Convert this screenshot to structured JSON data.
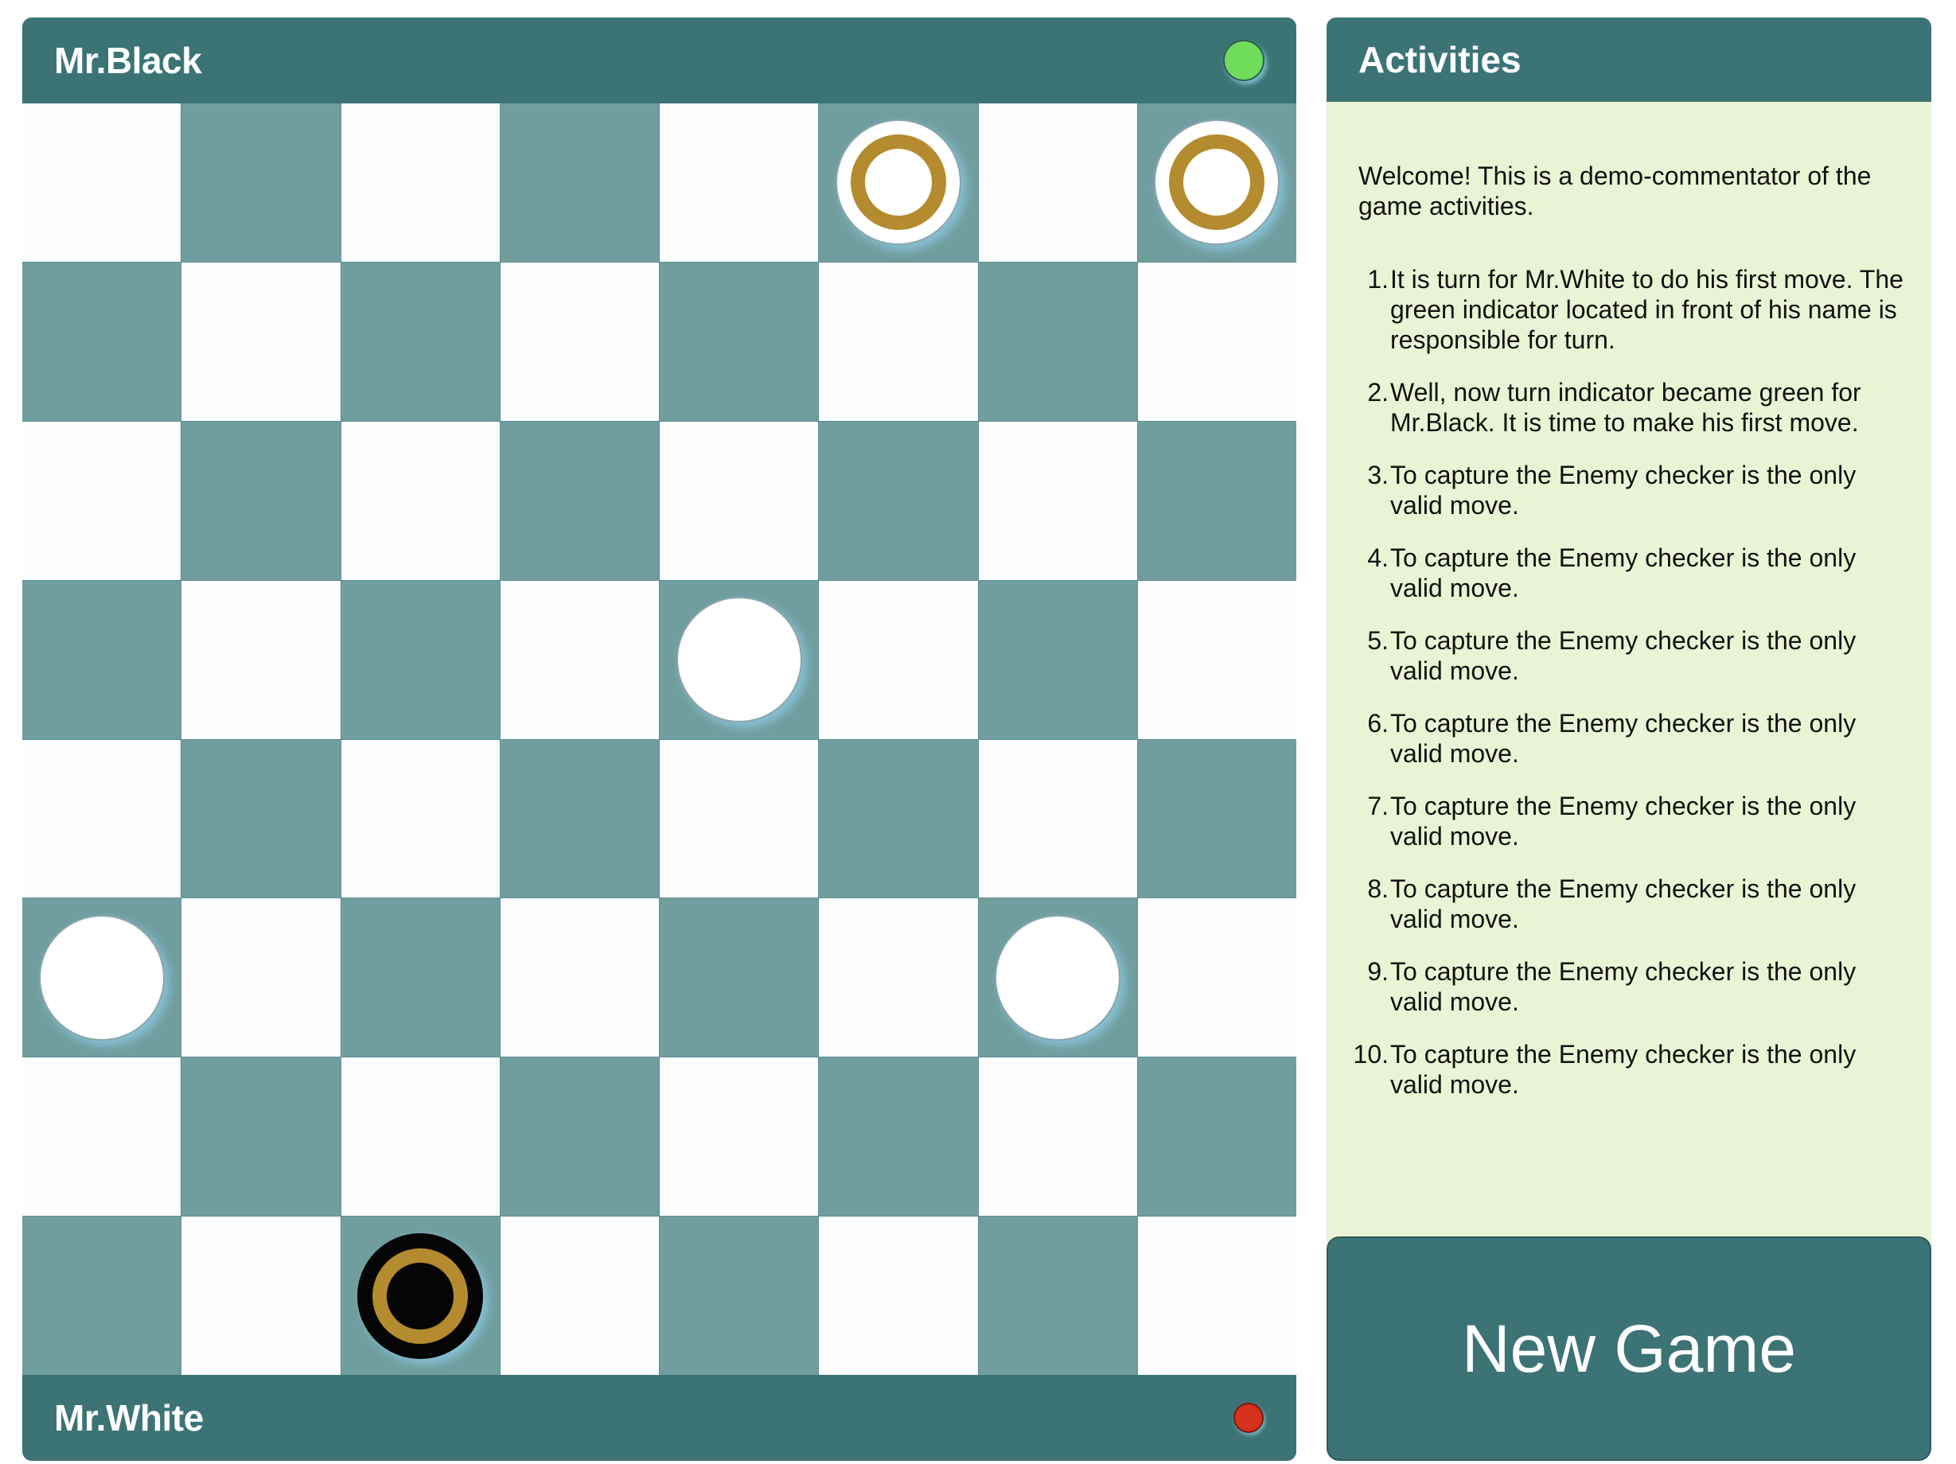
{
  "players": {
    "top": {
      "name": "Mr.Black",
      "indicator": "green",
      "indicator_color": "#6fdc5c"
    },
    "bottom": {
      "name": "Mr.White",
      "indicator": "red",
      "indicator_color": "#d6311d"
    }
  },
  "board": {
    "rows": 8,
    "cols": 8,
    "pieces": [
      {
        "row": 0,
        "col": 5,
        "color": "white",
        "king": true
      },
      {
        "row": 0,
        "col": 7,
        "color": "white",
        "king": true
      },
      {
        "row": 3,
        "col": 4,
        "color": "white",
        "king": false
      },
      {
        "row": 5,
        "col": 0,
        "color": "white",
        "king": false
      },
      {
        "row": 5,
        "col": 6,
        "color": "white",
        "king": false
      },
      {
        "row": 7,
        "col": 2,
        "color": "black",
        "king": true
      }
    ],
    "colors": {
      "light": "#fdfdfd",
      "dark": "#709e9f",
      "king_ring": "#b48b2e"
    }
  },
  "activities": {
    "title": "Activities",
    "welcome": "Welcome! This is a demo-commentator of the game activities.",
    "log": [
      "It is turn for Mr.White to do his first move. The green indicator located in front of his name is responsible for turn.",
      "Well, now turn indicator became green for Mr.Black. It is time to make his first move.",
      "To capture the Enemy checker is the only valid move.",
      "To capture the Enemy checker is the only valid move.",
      "To capture the Enemy checker is the only valid move.",
      "To capture the Enemy checker is the only valid move.",
      "To capture the Enemy checker is the only valid move.",
      "To capture the Enemy checker is the only valid move.",
      "To capture the Enemy checker is the only valid move.",
      "To capture the Enemy checker is the only valid move."
    ]
  },
  "new_game_label": "New Game",
  "theme": {
    "accent": "#3c7476",
    "panel_bg": "#eaf4d4"
  }
}
